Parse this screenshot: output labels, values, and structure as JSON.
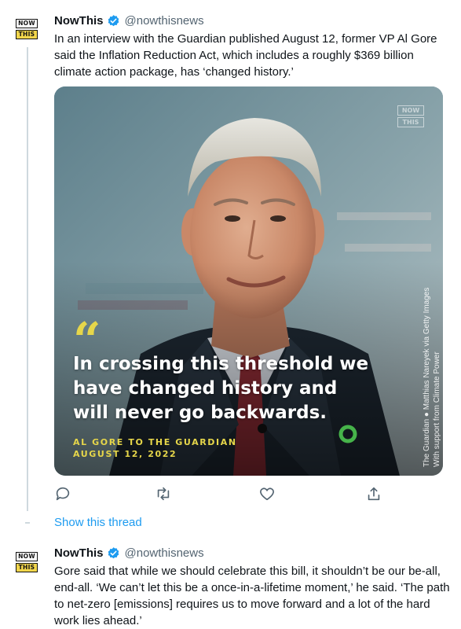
{
  "brand": {
    "logo_line1": "NOW",
    "logo_line2": "THIS"
  },
  "tweets": [
    {
      "name": "NowThis",
      "handle": "@nowthisnews",
      "text": "In an interview with the Guardian published August 12, former VP Al Gore said the Inflation Reduction Act, which includes a roughly $369 billion climate action package, has ‘changed history.’"
    },
    {
      "name": "NowThis",
      "handle": "@nowthisnews",
      "text": "Gore said that while we should celebrate this bill, it shouldn’t be our be-all, end-all. ‘We can’t let this be a once-in-a-lifetime moment,’ he said. ‘The path to net-zero [emissions] requires us to move forward and a lot of the hard work lies ahead.’"
    }
  ],
  "media": {
    "quote_mark": "“",
    "quote": "In crossing this threshold we have changed history and will never go backwards.",
    "attribution_line1": "AL GORE TO THE GUARDIAN",
    "attribution_line2": "AUGUST 12, 2022",
    "credit_line1": "The Guardian  ● Matthias Nareyek via Getty Images",
    "credit_line2": "With support from Climate Power",
    "watermark_line1": "NOW",
    "watermark_line2": "THIS"
  },
  "show_thread_label": "Show this thread",
  "colors": {
    "accent": "#1d9bf0",
    "brand_yellow": "#f2d64b",
    "quote_yellow": "#e6d64a",
    "climate_green": "#46b34a"
  },
  "icons": [
    "reply-icon",
    "retweet-icon",
    "like-icon",
    "share-icon",
    "verified-icon"
  ]
}
